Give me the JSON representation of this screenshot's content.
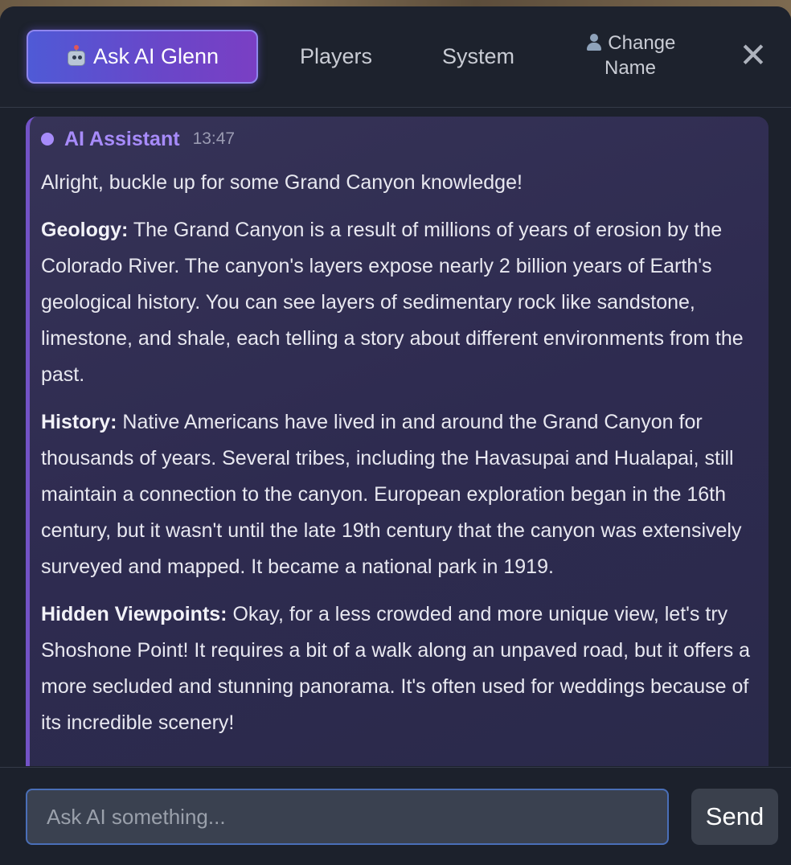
{
  "header": {
    "tabs": {
      "ask_ai": "Ask AI Glenn",
      "players": "Players",
      "system": "System",
      "change_name_line1": "Change",
      "change_name_line2": "Name"
    },
    "close_symbol": "✕",
    "icons": {
      "ask_ai": "robot-icon",
      "change_name": "person-icon",
      "close": "close-icon"
    }
  },
  "message": {
    "author": "AI Assistant",
    "time": "13:47",
    "intro": "Alright, buckle up for some Grand Canyon knowledge!",
    "sections": [
      {
        "heading": "Geology:",
        "text": " The Grand Canyon is a result of millions of years of erosion by the Colorado River. The canyon's layers expose nearly 2 billion years of Earth's geological history. You can see layers of sedimentary rock like sandstone, limestone, and shale, each telling a story about different environments from the past."
      },
      {
        "heading": "History:",
        "text": " Native Americans have lived in and around the Grand Canyon for thousands of years. Several tribes, including the Havasupai and Hualapai, still maintain a connection to the canyon. European exploration began in the 16th century, but it wasn't until the late 19th century that the canyon was extensively surveyed and mapped. It became a national park in 1919."
      },
      {
        "heading": "Hidden Viewpoints:",
        "text": " Okay, for a less crowded and more unique view, let's try Shoshone Point! It requires a bit of a walk along an unpaved road, but it offers a more secluded and stunning panorama. It's often used for weddings because of its incredible scenery!"
      }
    ]
  },
  "footer": {
    "input_placeholder": "Ask AI something...",
    "input_value": "",
    "send_label": "Send"
  },
  "colors": {
    "accent": "#a78bfa",
    "tab_active_start": "#4f5ad6",
    "tab_active_end": "#7a3fc4",
    "panel_bg": "#1c212c",
    "card_border": "#7353c6"
  }
}
